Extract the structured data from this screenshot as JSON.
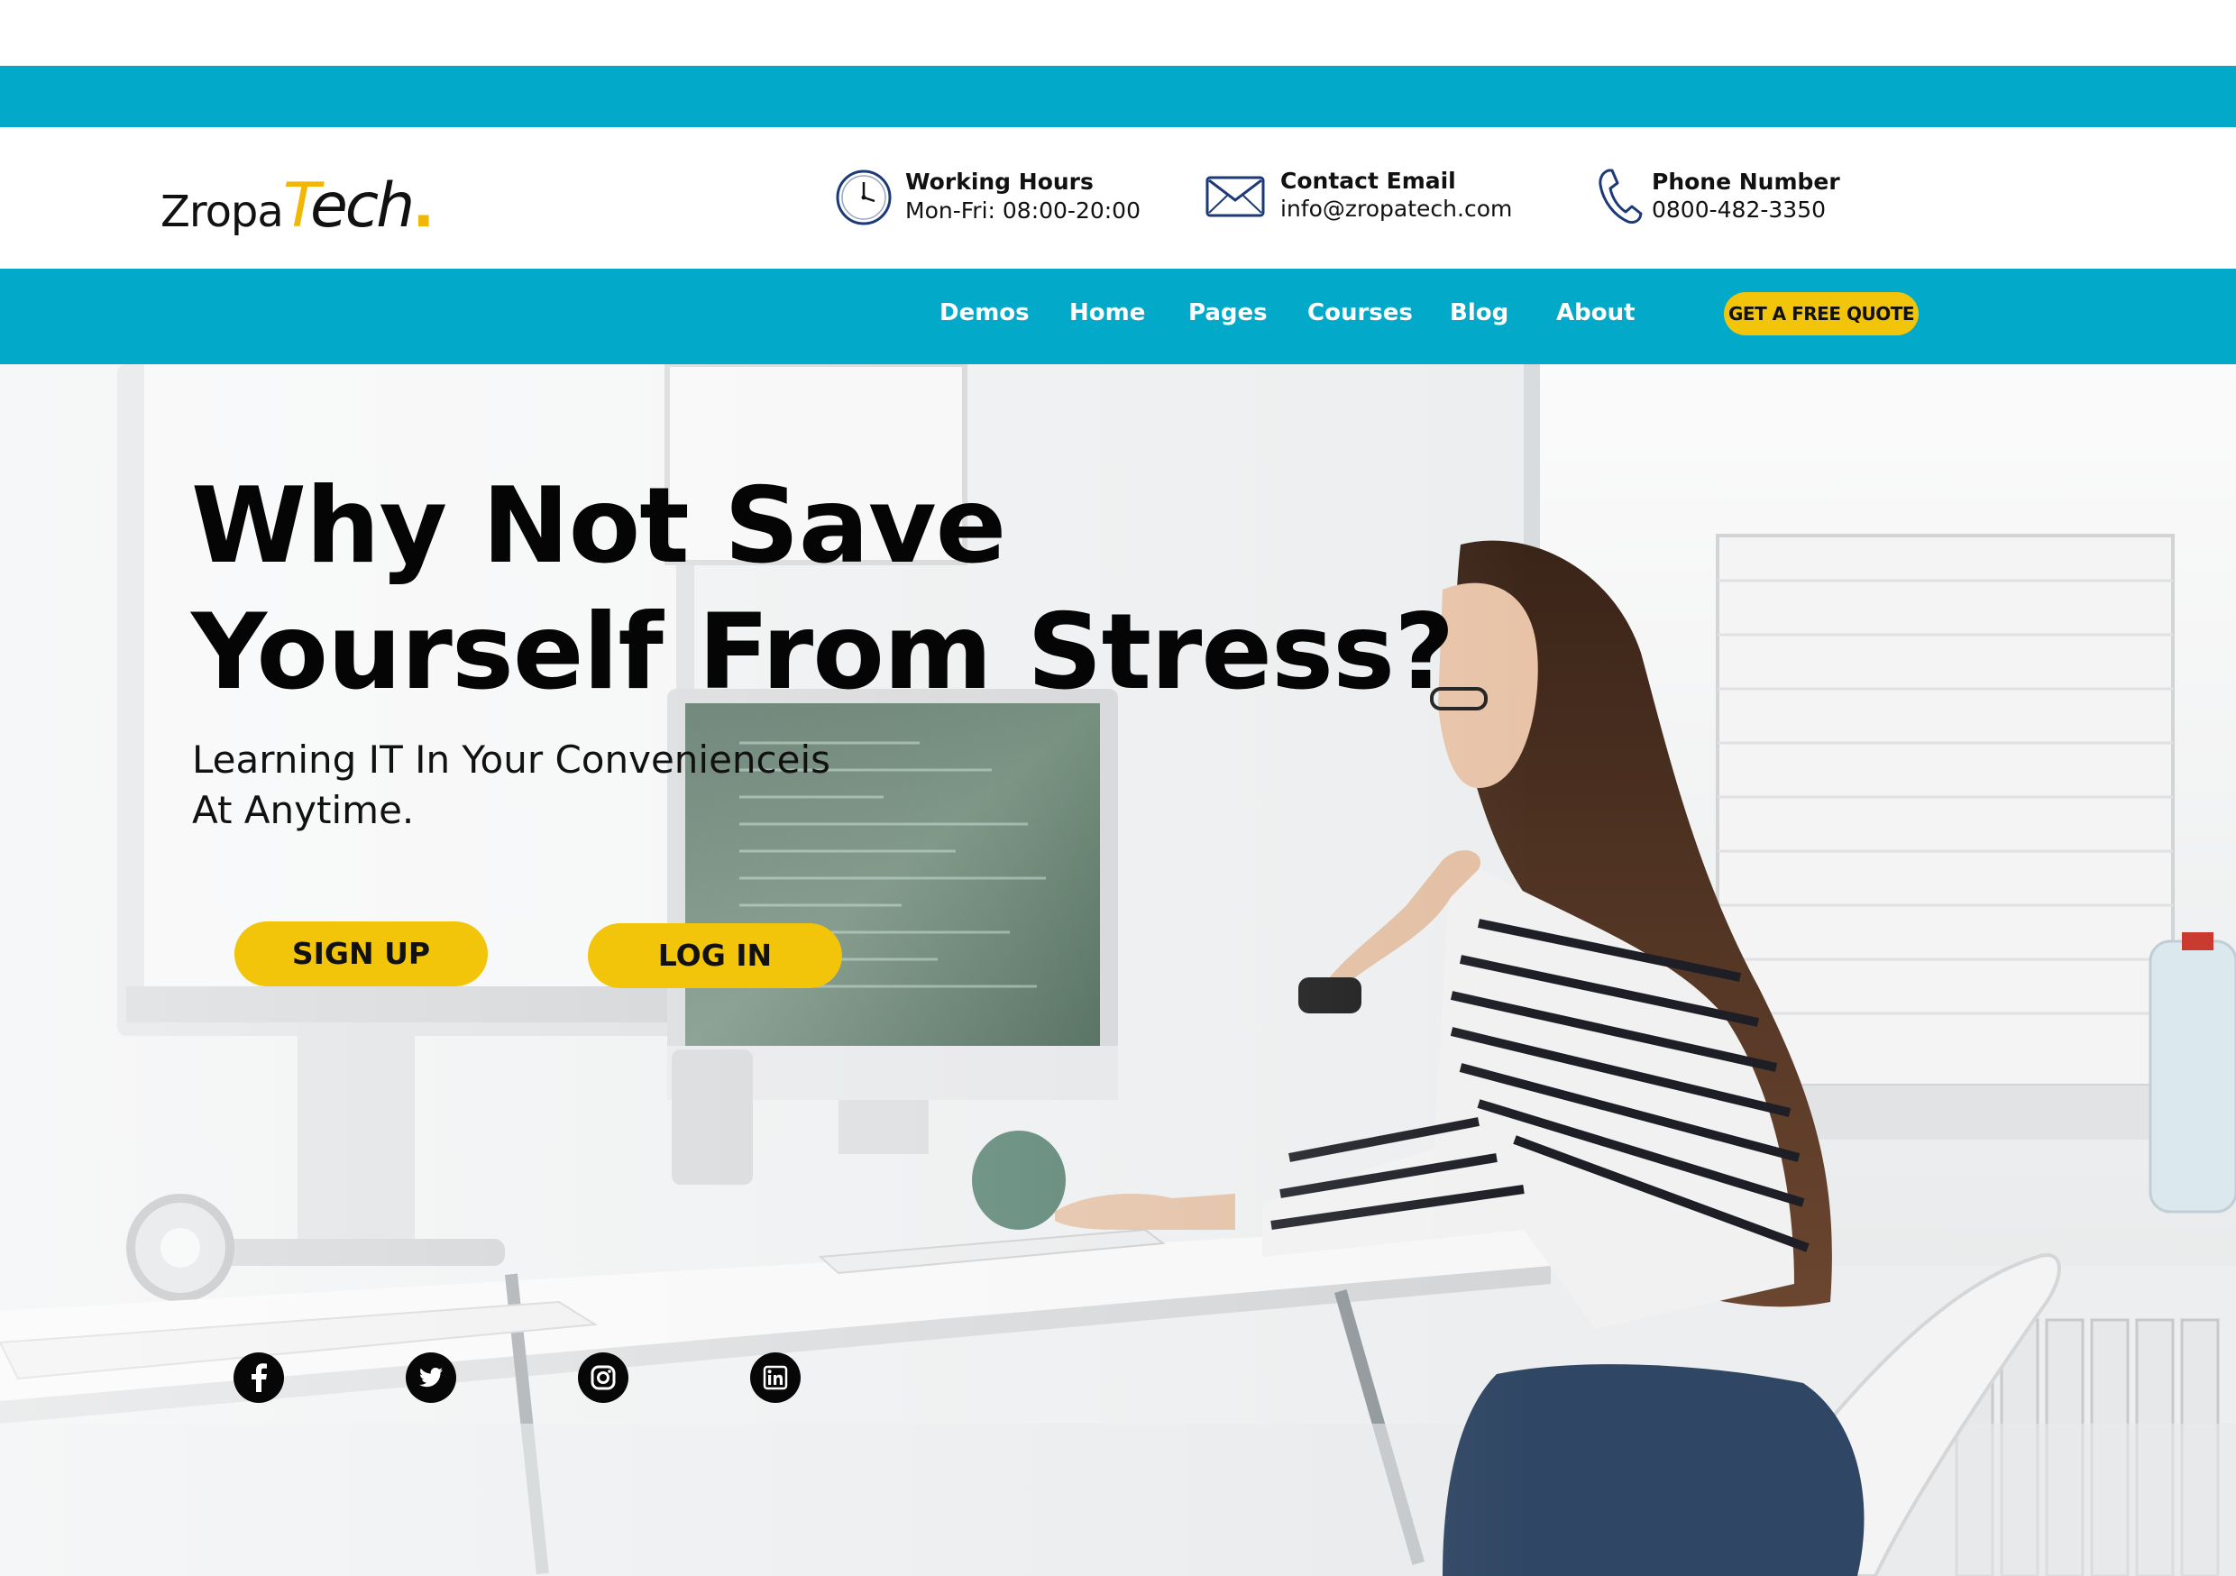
{
  "brand": {
    "logo_part1": "Zropa",
    "logo_part2_first": "T",
    "logo_part2_rest": "ech",
    "logo_dot": "."
  },
  "header": {
    "working_hours": {
      "title": "Working Hours",
      "value": "Mon-Fri: 08:00-20:00",
      "icon": "clock-icon"
    },
    "contact_email": {
      "title": "Contact Email",
      "value": "info@zropatech.com",
      "icon": "envelope-icon"
    },
    "phone": {
      "title": "Phone Number",
      "value": "0800-482-3350",
      "icon": "phone-icon"
    }
  },
  "nav": {
    "items": [
      {
        "label": "Demos"
      },
      {
        "label": "Home"
      },
      {
        "label": "Pages"
      },
      {
        "label": "Courses"
      },
      {
        "label": "Blog"
      },
      {
        "label": "About"
      }
    ],
    "cta": "GET A FREE QUOTE"
  },
  "hero": {
    "title_line1": "Why Not Save",
    "title_line2": "Yourself From Stress?",
    "subtitle_line1": "Learning IT In Your Convenienceis",
    "subtitle_line2": "At Anytime.",
    "signup_label": "SIGN UP",
    "login_label": "LOG IN"
  },
  "social": [
    "facebook-icon",
    "twitter-icon",
    "instagram-icon",
    "linkedin-icon"
  ],
  "colors": {
    "accent": "#03a9c9",
    "button": "#f2c40a",
    "text": "#111111",
    "brand_yellow": "#f2b705"
  }
}
